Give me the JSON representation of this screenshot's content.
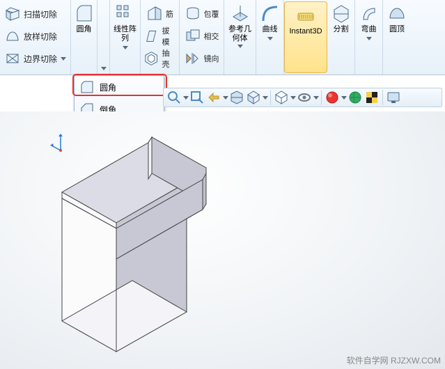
{
  "ribbon": {
    "left_rows": [
      {
        "label": "扫描切除"
      },
      {
        "label": "放样切除"
      },
      {
        "label": "边界切除"
      }
    ],
    "fillet": {
      "label": "圆角"
    },
    "pattern": {
      "label": "线性阵\n列"
    },
    "mid_rows": [
      {
        "label": "筋"
      },
      {
        "label": "拔模"
      },
      {
        "label": "抽壳"
      }
    ],
    "mid2_rows": [
      {
        "label": "包覆"
      },
      {
        "label": "相交"
      },
      {
        "label": "镜向"
      }
    ],
    "refgeo": {
      "label": "参考几\n何体"
    },
    "curve": {
      "label": "曲线"
    },
    "instant3d": {
      "label": "Instant3D"
    },
    "split": {
      "label": "分割"
    },
    "bend": {
      "label": "弯曲"
    },
    "dome": {
      "label": "圆顶"
    }
  },
  "menu": {
    "items": [
      {
        "label": "圆角"
      },
      {
        "label": "倒角"
      }
    ]
  },
  "watermark": {
    "text": "软件自学网  RJZXW.COM"
  }
}
